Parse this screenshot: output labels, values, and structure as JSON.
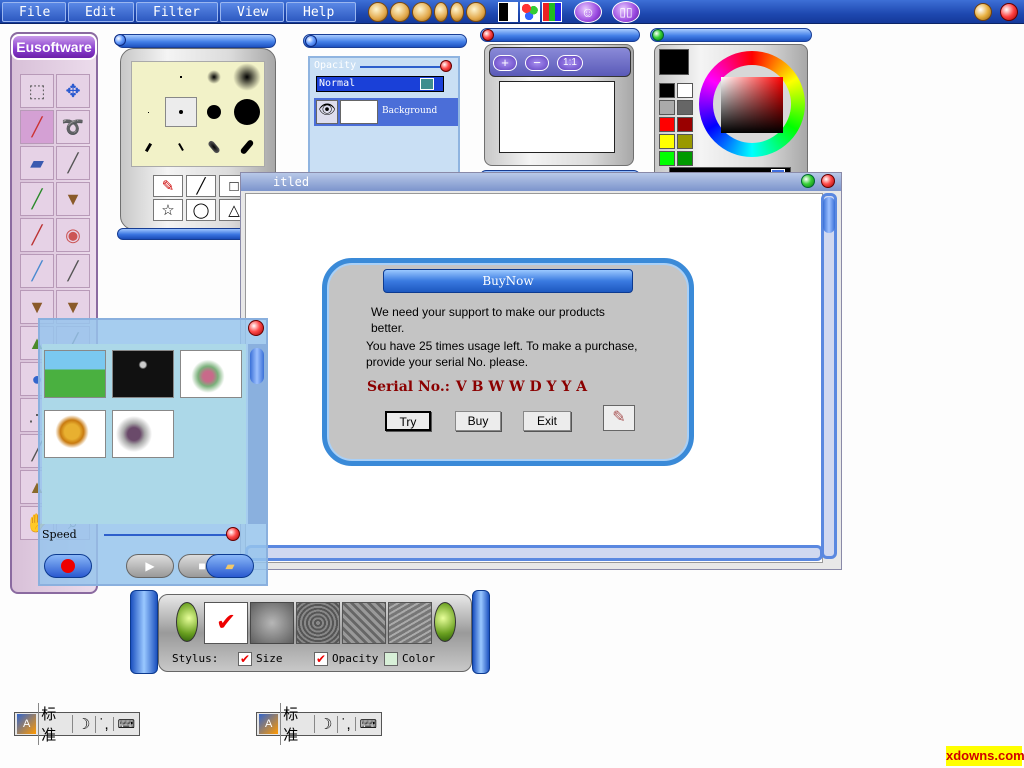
{
  "menu": [
    "File",
    "Edit",
    "Filter",
    "View",
    "Help"
  ],
  "toolbar_icons": [
    "open-icon",
    "new-icon",
    "save-icon",
    "back-icon",
    "forward-icon",
    "home-icon",
    "contrast-icon",
    "palette-icon",
    "color-bars-icon",
    "smiley-icon",
    "book-icon"
  ],
  "brand": "Eusoftware",
  "layers": {
    "opacity_label": "Opacity",
    "blend_mode": "Normal",
    "layer_name": "Background"
  },
  "navigator": {
    "zoom_in": "+",
    "zoom_out": "−",
    "zoom_actual": "1:1"
  },
  "document": {
    "title_fragment": "itled"
  },
  "dialog": {
    "title": "BuyNow",
    "line1": "We need your support to make our products",
    "line2": "better.",
    "line3": "You have 25 times usage left. To make a purchase,",
    "line4": "provide your serial No. please.",
    "serial_label": "Serial No.:",
    "serial_value": "V B W W D Y Y A",
    "try": "Try",
    "buy": "Buy",
    "exit": "Exit"
  },
  "scripts": {
    "speed_label": "Speed"
  },
  "stylus": {
    "label": "Stylus:",
    "size": "Size",
    "opacity": "Opacity",
    "color": "Color"
  },
  "ime": {
    "mode": "标准"
  },
  "watermark": "xdowns.com",
  "colors": {
    "accent": "#2d5fcc",
    "serial": "#8b0000",
    "watermark_bg": "#ffff00"
  }
}
